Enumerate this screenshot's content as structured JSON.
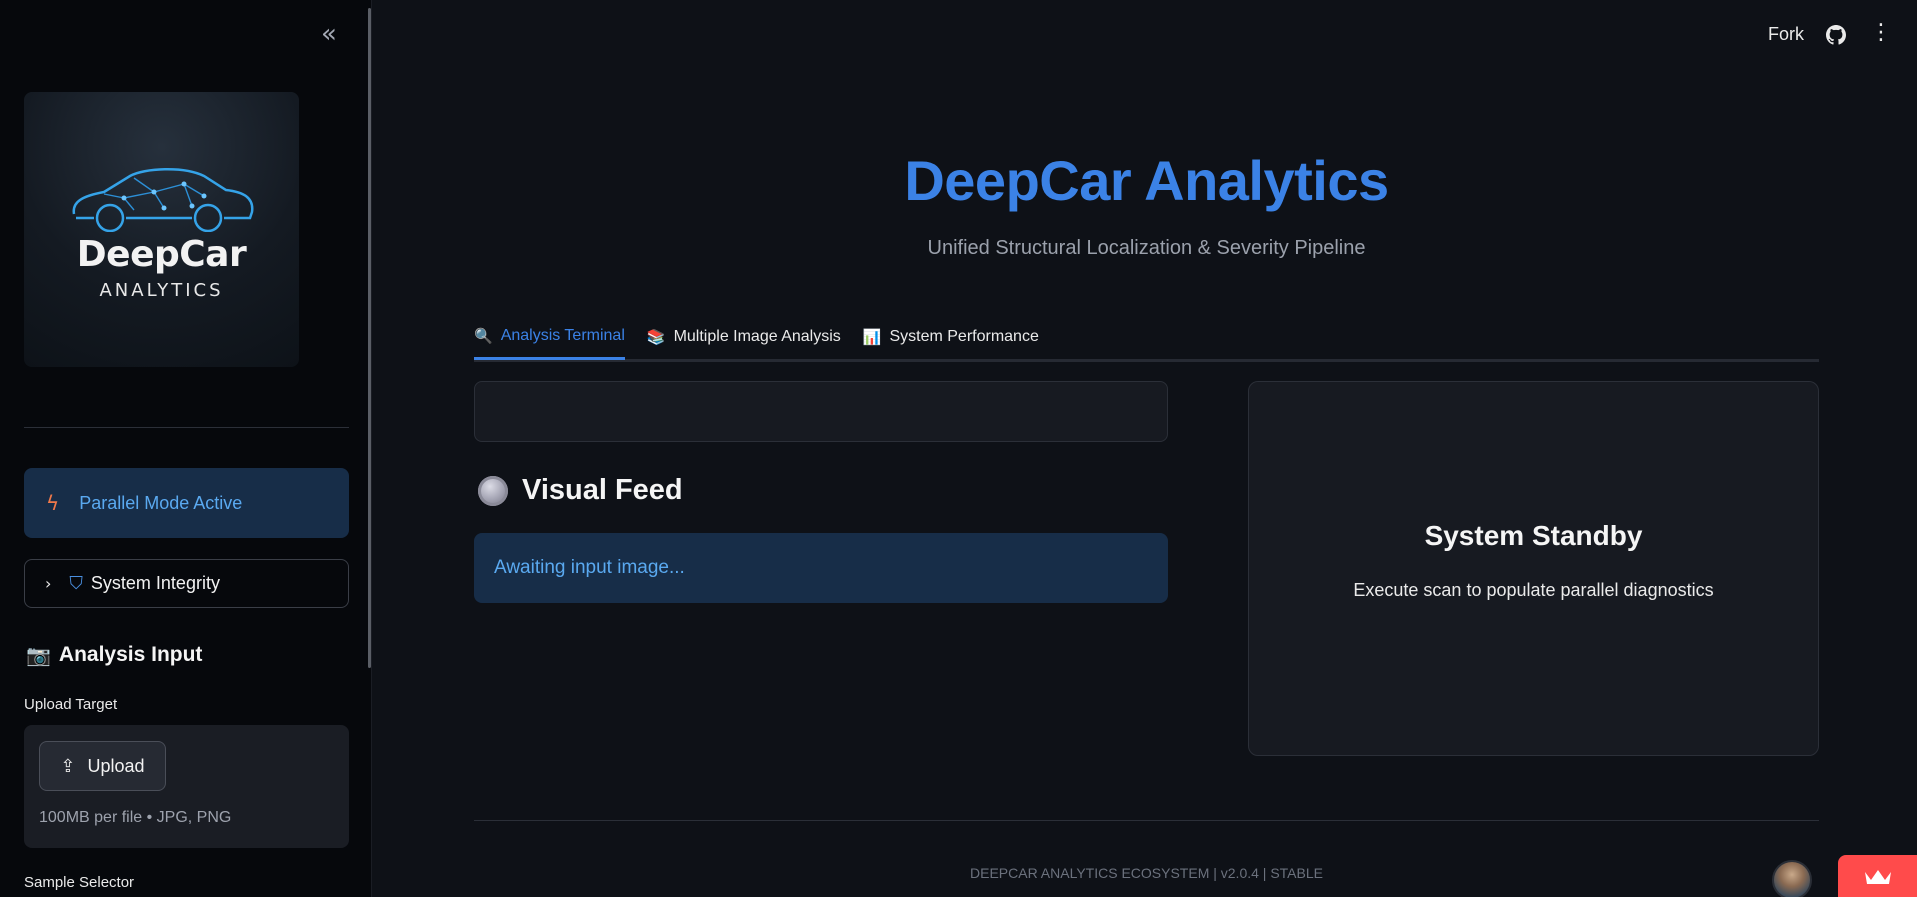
{
  "sidebar": {
    "collapse_icon": "double-chevron-left-icon",
    "logo": {
      "title": "DeepCar",
      "subtitle": "ANALYTICS"
    },
    "mode_info": {
      "icon": "lightning-icon",
      "label": "Parallel Mode Active"
    },
    "integrity": {
      "chevron": "chevron-right-icon",
      "icon": "shield-icon",
      "label": "System Integrity"
    },
    "analysis_input": {
      "icon": "camera-icon",
      "heading": "Analysis Input",
      "upload_label": "Upload Target",
      "upload_button": "Upload",
      "upload_hint": "100MB per file • JPG, PNG",
      "sample_label": "Sample Selector"
    }
  },
  "header": {
    "fork": "Fork",
    "github_icon": "github-icon",
    "menu_icon": "kebab-menu-icon"
  },
  "main": {
    "title": "DeepCar Analytics",
    "subtitle": "Unified Structural Localization & Severity Pipeline",
    "tabs": [
      {
        "emoji": "🔍",
        "label": "Analysis Terminal",
        "active": true
      },
      {
        "emoji": "📚",
        "label": "Multiple Image Analysis",
        "active": false
      },
      {
        "emoji": "📊",
        "label": "System Performance",
        "active": false
      }
    ],
    "visual_feed": {
      "heading": "Visual Feed",
      "status": "Awaiting input image..."
    },
    "standby": {
      "title": "System Standby",
      "subtitle": "Execute scan to populate parallel diagnostics"
    }
  },
  "footer": {
    "text": "DEEPCAR ANALYTICS ECOSYSTEM | v2.0.4 | STABLE"
  },
  "colors": {
    "accent": "#3b82e6",
    "info_bg": "#172d48",
    "info_text": "#5aa9f0",
    "badge": "#ff4b4b"
  }
}
